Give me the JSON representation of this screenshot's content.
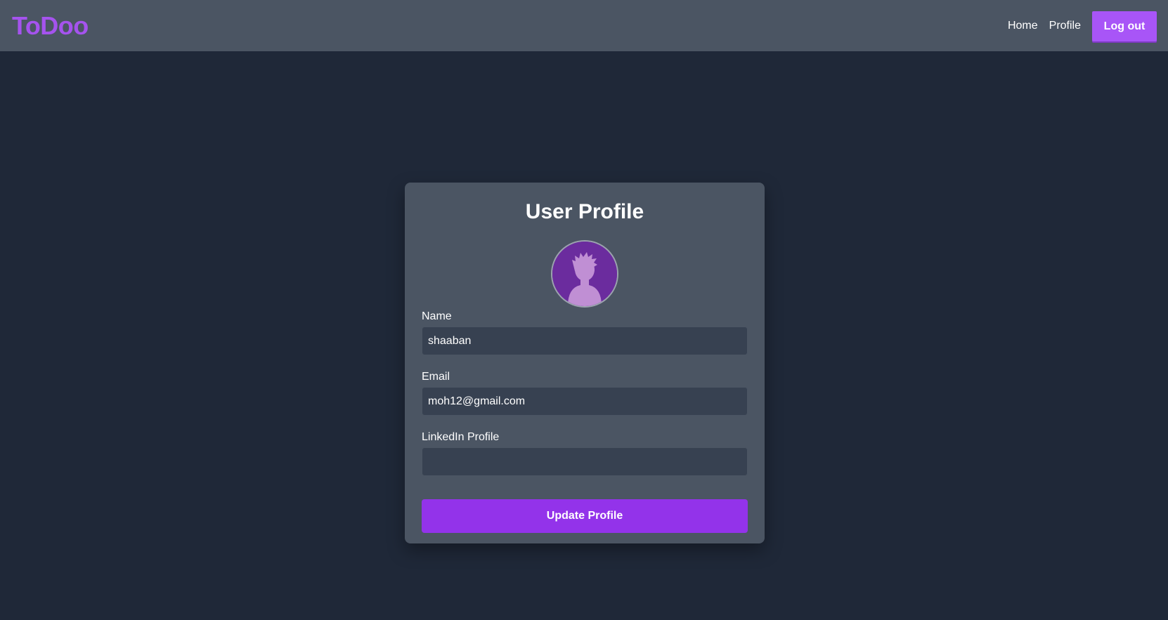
{
  "navbar": {
    "brand": "ToDoo",
    "links": [
      {
        "label": "Home"
      },
      {
        "label": "Profile"
      }
    ],
    "logout_label": "Log out"
  },
  "profile": {
    "title": "User Profile",
    "avatar_icon": "user-silhouette-icon",
    "fields": {
      "name": {
        "label": "Name",
        "value": "shaaban"
      },
      "email": {
        "label": "Email",
        "value": "moh12@gmail.com"
      },
      "linkedin": {
        "label": "LinkedIn Profile",
        "value": ""
      }
    },
    "submit_label": "Update Profile"
  },
  "colors": {
    "background": "#1f2838",
    "navbar": "#4b5563",
    "brand": "#a553ee",
    "accent": "#9333ea",
    "logout": "#a855f7",
    "input_bg": "#374151"
  }
}
